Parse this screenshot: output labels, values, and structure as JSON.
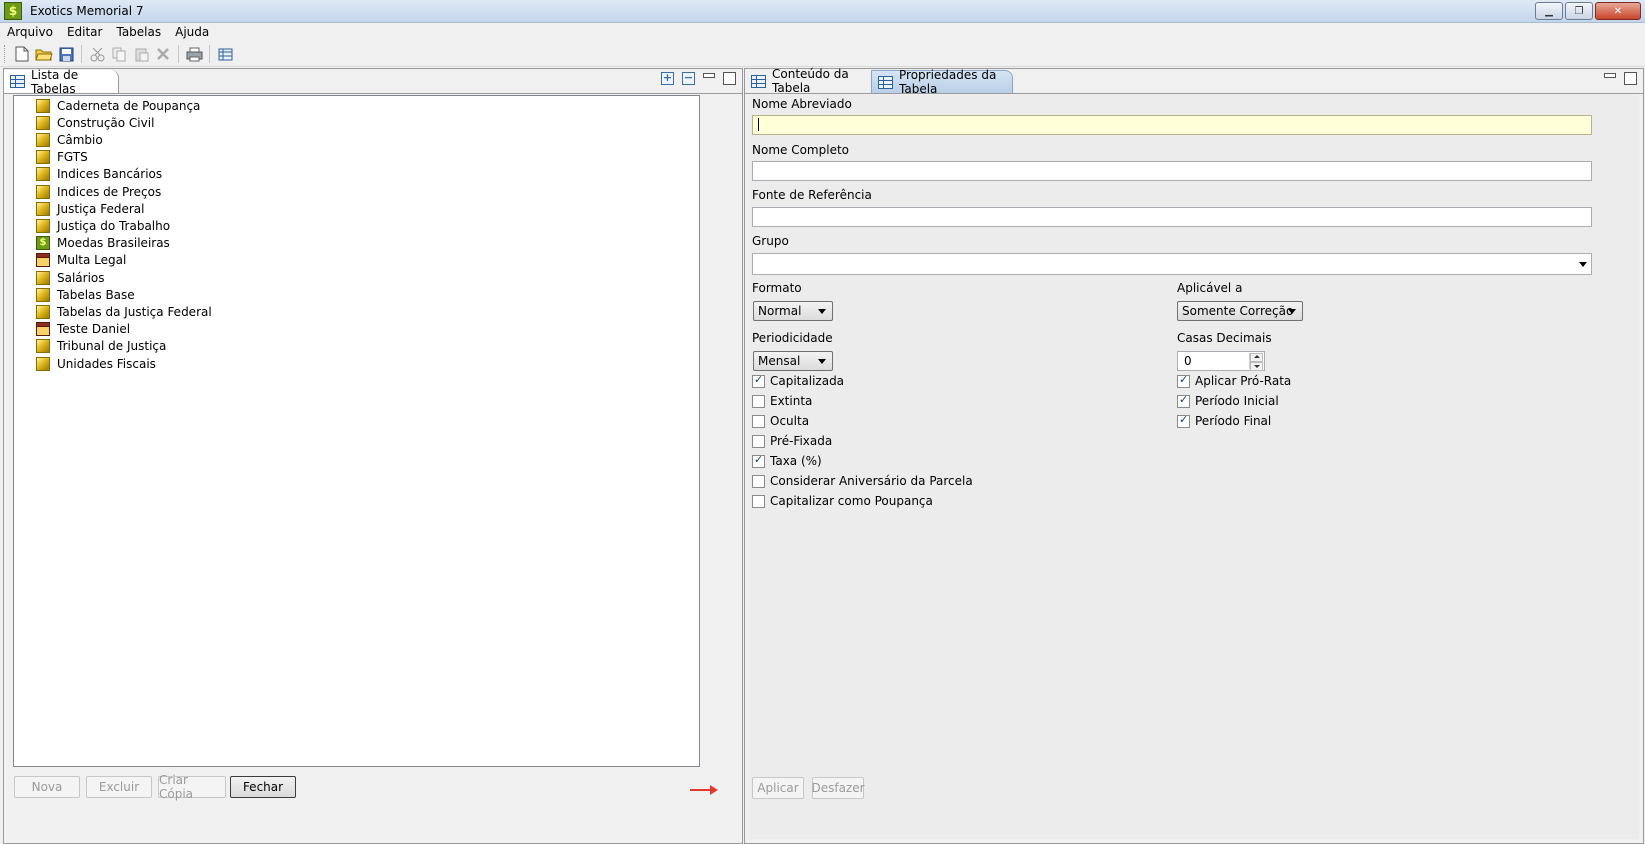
{
  "window": {
    "title": "Exotics Memorial 7",
    "app_icon_glyph": "$",
    "controls": {
      "minimize": "▁",
      "restore": "❐",
      "close": "✕"
    }
  },
  "menu": [
    "Arquivo",
    "Editar",
    "Tabelas",
    "Ajuda"
  ],
  "toolbar": {
    "icons": [
      "new-file-icon",
      "open-folder-icon",
      "save-icon",
      "cut-icon",
      "copy-icon",
      "paste-icon",
      "delete-icon",
      "print-icon",
      "table-icon"
    ]
  },
  "left_panel": {
    "tab_label": "Lista de Tabelas",
    "tree_items": [
      {
        "label": "Caderneta de Poupança",
        "icon": "folder"
      },
      {
        "label": "Construção Civil",
        "icon": "folder"
      },
      {
        "label": "Câmbio",
        "icon": "folder"
      },
      {
        "label": "FGTS",
        "icon": "folder"
      },
      {
        "label": "Indices Bancários",
        "icon": "folder"
      },
      {
        "label": "Indices de Preços",
        "icon": "folder"
      },
      {
        "label": "Justiça Federal",
        "icon": "folder"
      },
      {
        "label": "Justiça do Trabalho",
        "icon": "folder"
      },
      {
        "label": "Moedas Brasileiras",
        "icon": "money"
      },
      {
        "label": "Multa Legal",
        "icon": "table"
      },
      {
        "label": "Salários",
        "icon": "folder"
      },
      {
        "label": "Tabelas Base",
        "icon": "folder"
      },
      {
        "label": "Tabelas da Justiça Federal",
        "icon": "folder"
      },
      {
        "label": "Teste Daniel",
        "icon": "table"
      },
      {
        "label": "Tribunal de Justiça",
        "icon": "folder"
      },
      {
        "label": "Unidades Fiscais",
        "icon": "folder"
      }
    ],
    "buttons": {
      "nova": "Nova",
      "excluir": "Excluir",
      "criar_copia": "Criar Cópia",
      "fechar": "Fechar"
    }
  },
  "right_panel": {
    "tabs": [
      "Conteúdo da Tabela",
      "Propriedades da Tabela"
    ],
    "nome_abreviado": {
      "label": "Nome Abreviado",
      "value": ""
    },
    "nome_completo": {
      "label": "Nome Completo",
      "value": ""
    },
    "fonte_referencia": {
      "label": "Fonte de Referência",
      "value": ""
    },
    "grupo": {
      "label": "Grupo",
      "value": ""
    },
    "formato": {
      "label": "Formato",
      "value": "Normal"
    },
    "aplicavel": {
      "label": "Aplicável a",
      "value": "Somente Correção"
    },
    "periodicidade": {
      "label": "Periodicidade",
      "value": "Mensal"
    },
    "casas_decimais": {
      "label": "Casas Decimais",
      "value": "0"
    },
    "checkboxes_left": [
      {
        "label": "Capitalizada",
        "checked": true
      },
      {
        "label": "Extinta",
        "checked": false
      },
      {
        "label": "Oculta",
        "checked": false
      },
      {
        "label": "Pré-Fixada",
        "checked": false
      },
      {
        "label": "Taxa (%)",
        "checked": true
      },
      {
        "label": "Considerar Aniversário da Parcela",
        "checked": false
      },
      {
        "label": "Capitalizar como Poupança",
        "checked": false
      }
    ],
    "checkboxes_right": [
      {
        "label": "Aplicar Pró-Rata",
        "checked": true
      },
      {
        "label": "Período Inicial",
        "checked": true
      },
      {
        "label": "Período Final",
        "checked": true
      }
    ],
    "buttons": {
      "aplicar": "Aplicar",
      "desfazer": "Desfazer"
    }
  },
  "colors": {
    "annotation_arrow": "#e03a2c",
    "focused_field": "#ffffd8"
  }
}
